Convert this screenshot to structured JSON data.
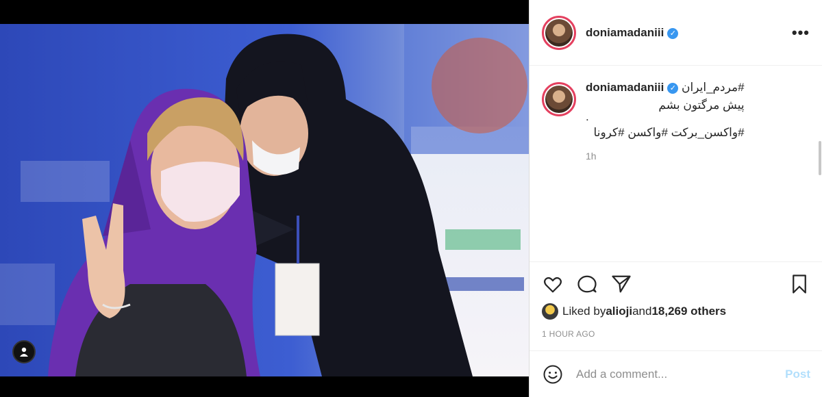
{
  "post": {
    "username": "doniamadaniii",
    "verified_mark": "✓",
    "more_label": "•••"
  },
  "caption": {
    "username": "doniamadaniii",
    "hashtag_top": "#مردم_ایران",
    "line1": "پیش مرگتون بشم",
    "dot": ".",
    "hashtags": "#واکسن_برکت #واکسن #کرونا",
    "time_ago": "1h"
  },
  "likes": {
    "prefix": "Liked by ",
    "user": "alioji",
    "middle": " and ",
    "count": "18,269 others"
  },
  "timestamp": "1 HOUR AGO",
  "comment": {
    "placeholder": "Add a comment...",
    "post_label": "Post"
  },
  "icons": {
    "like": "heart-icon",
    "comment": "comment-icon",
    "share": "share-icon",
    "save": "bookmark-icon",
    "emoji": "smiley-icon",
    "tag": "user-tag-icon"
  },
  "colors": {
    "verified": "#3897f0",
    "avatar_ring": "#e4405f",
    "post_button": "#b2dffc"
  }
}
